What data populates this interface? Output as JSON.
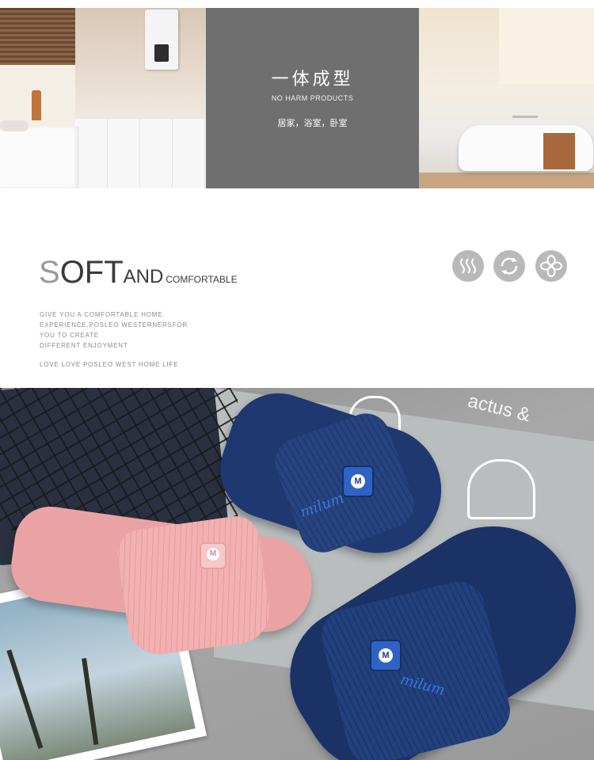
{
  "banner": {
    "title": "一体成型",
    "subtitle": "NO HARM PRODUCTS",
    "rooms": "居家，浴室，卧室"
  },
  "heading": {
    "soft_first": "S",
    "soft_rest": "OFT",
    "and": "AND",
    "comfortable": "COMFORTABLE"
  },
  "description": {
    "lines": [
      "GIVE YOU A COMFORTABLE HOME",
      "EXPERIENCE,POSLEO WESTERNERSFOR",
      "YOU TO CREATE",
      "DIFFERENT ENJOYMENT"
    ],
    "footer": "LOVE LOVE POSLEO WEST HOME LIFE"
  },
  "feature_icons": [
    "steam-wave-icon",
    "recycle-arrows-icon",
    "flower-petal-icon"
  ],
  "photo": {
    "mat_text": "actus &",
    "badge_letter": "M",
    "colors": {
      "pink": "#eaa3a5",
      "navy": "#1f3870",
      "accent_blue": "#3a78e0"
    }
  }
}
